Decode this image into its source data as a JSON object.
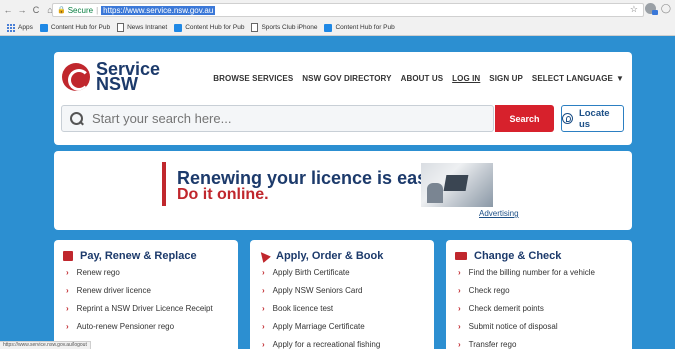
{
  "browser": {
    "secure_label": "Secure",
    "url": "https://www.service.nsw.gov.au",
    "bookmarks": [
      {
        "label": "Apps",
        "icon": "apps-grid-icon"
      },
      {
        "label": "Content Hub for Pub",
        "icon": "content-hub-icon"
      },
      {
        "label": "News Intranet",
        "icon": "document-icon"
      },
      {
        "label": "Content Hub for Pub",
        "icon": "content-hub-icon"
      },
      {
        "label": "Sports Club iPhone",
        "icon": "document-icon"
      },
      {
        "label": "Content Hub for Pub",
        "icon": "content-hub-icon"
      }
    ],
    "status_url": "https://www.service.nsw.gov.au/logout"
  },
  "header": {
    "logo_line1": "Service",
    "logo_line2": "NSW",
    "nav": [
      "BROWSE SERVICES",
      "NSW GOV DIRECTORY",
      "ABOUT US",
      "LOG IN",
      "SIGN UP",
      "SELECT LANGUAGE"
    ],
    "search_placeholder": "Start your search here...",
    "search_button": "Search",
    "locate_button": "Locate us"
  },
  "banner": {
    "line1": "Renewing your licence is easy.",
    "line2": "Do it online.",
    "ad_link": "Advertising"
  },
  "categories": [
    {
      "title": "Pay, Renew & Replace",
      "icon": "card-icon",
      "items": [
        "Renew rego",
        "Renew driver licence",
        "Reprint a NSW Driver Licence Receipt",
        "Auto-renew Pensioner rego"
      ]
    },
    {
      "title": "Apply, Order & Book",
      "icon": "cursor-icon",
      "items": [
        "Apply Birth Certificate",
        "Apply NSW Seniors Card",
        "Book licence test",
        "Apply Marriage Certificate",
        "Apply for a recreational fishing"
      ]
    },
    {
      "title": "Change & Check",
      "icon": "id-card-icon",
      "items": [
        "Find the billing number for a vehicle",
        "Check rego",
        "Check demerit points",
        "Submit notice of disposal",
        "Transfer rego"
      ]
    }
  ],
  "colors": {
    "page_bg": "#2c8fd1",
    "brand_navy": "#1c3a6b",
    "brand_red": "#c0272d",
    "search_red": "#d7212c"
  }
}
